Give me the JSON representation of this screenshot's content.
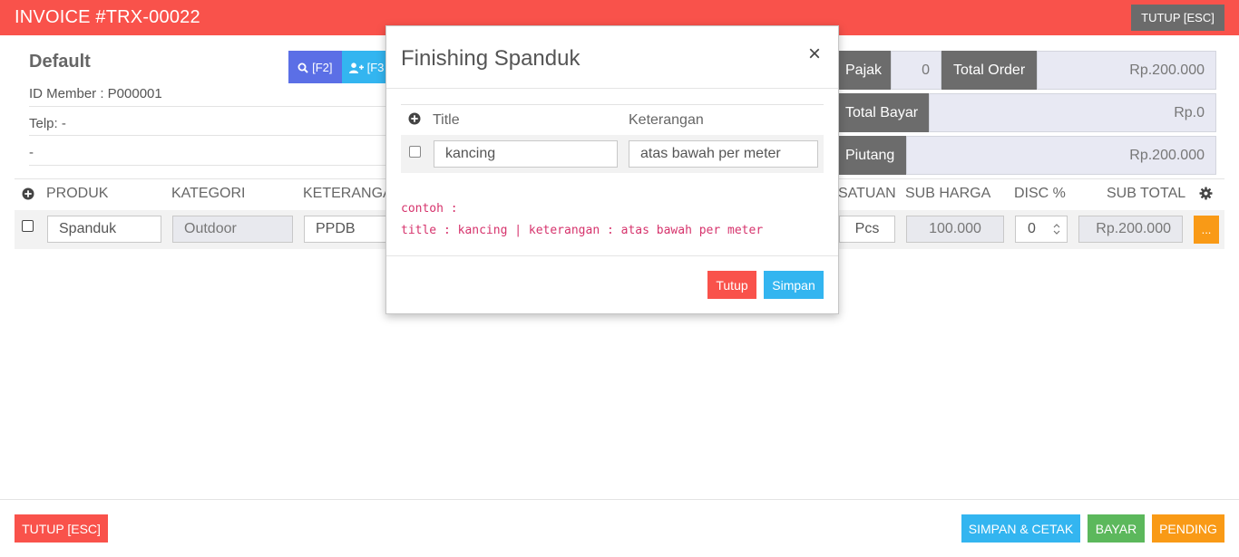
{
  "header": {
    "title": "INVOICE #TRX-00022",
    "close_label": "TUTUP [ESC]"
  },
  "customer": {
    "name": "Default",
    "member_id": "ID Member : P000001",
    "phone": "Telp: -",
    "address": "-"
  },
  "actions": {
    "search_label": "[F2]",
    "add_member_label": "[F3"
  },
  "summary": {
    "pajak_label": "Pajak",
    "pajak_value": "0",
    "total_order_label": "Total Order",
    "total_order_value": "Rp.200.000",
    "total_bayar_label": "Total Bayar",
    "total_bayar_value": "Rp.0",
    "piutang_label": "Piutang",
    "piutang_value": "Rp.200.000"
  },
  "table": {
    "columns": [
      "PRODUK",
      "KATEGORI",
      "KETERANGA",
      "SATUAN",
      "SUB HARGA",
      "DISC %",
      "SUB TOTAL"
    ],
    "row": {
      "produk": "Spanduk",
      "kategori": "Outdoor",
      "keterangan": "PPDB",
      "satuan": "Pcs",
      "sub_harga": "100.000",
      "disc": "0",
      "sub_total": "Rp.200.000",
      "more_label": "..."
    }
  },
  "modal": {
    "title": "Finishing Spanduk",
    "close_symbol": "×",
    "col_title": "Title",
    "col_keterangan": "Keterangan",
    "row": {
      "title": "kancing",
      "keterangan": "atas bawah per meter"
    },
    "note_line1": "contoh :",
    "note_line2": "title : kancing | keterangan : atas bawah per meter",
    "cancel_label": "Tutup",
    "save_label": "Simpan"
  },
  "footer": {
    "close_label": "TUTUP [ESC]",
    "save_print_label": "SIMPAN & CETAK",
    "pay_label": "BAYAR",
    "pending_label": "PENDING"
  },
  "colors": {
    "header_bg": "#f9524b",
    "danger": "#f9524b",
    "info": "#33b5f0",
    "success": "#5cb85c",
    "warning": "#f99a16",
    "primary": "#5b6fe6",
    "label_gray": "#6c6c6c"
  },
  "icons": [
    "search-icon",
    "user-plus-icon",
    "plus-circle-icon",
    "gear-icon",
    "checkbox-icon",
    "spinner-arrows-icon"
  ]
}
